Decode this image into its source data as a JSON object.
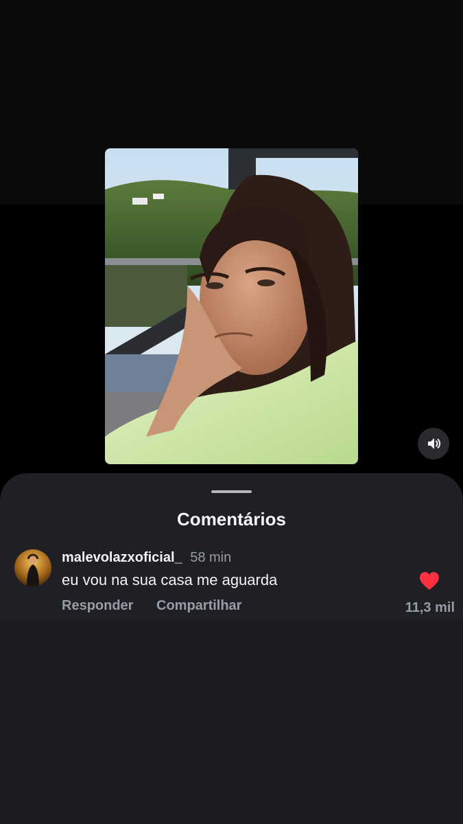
{
  "sheet": {
    "title": "Comentários"
  },
  "comments": [
    {
      "username": "malevolazxoficial_",
      "timestamp": "58 min",
      "text": "eu vou na sua casa me aguarda",
      "actions": {
        "reply": "Responder",
        "share": "Compartilhar"
      },
      "likes": "11,3 mil",
      "liked": true
    }
  ],
  "icons": {
    "mute": "speaker-icon",
    "like": "heart-icon",
    "drag": "drag-handle"
  },
  "colors": {
    "sheet_bg": "#1f2025",
    "heart": "#ff3040",
    "muted_text": "#9a9ca3"
  }
}
